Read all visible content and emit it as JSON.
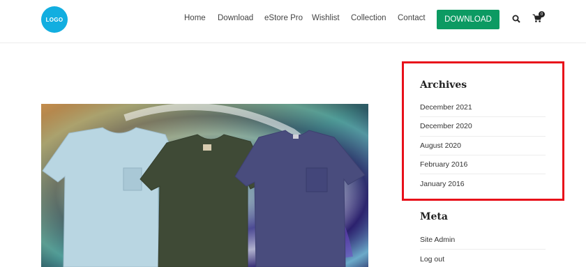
{
  "header": {
    "logo": "LOGO",
    "nav": [
      "Home",
      "Download",
      "eStore Pro",
      "Wishlist",
      "Collection",
      "Contact"
    ],
    "download_button": "DOWNLOAD",
    "cart_count": "0"
  },
  "sidebar": {
    "archives": {
      "title": "Archives",
      "items": [
        "December 2021",
        "December 2020",
        "August 2020",
        "February 2016",
        "January 2016"
      ]
    },
    "meta": {
      "title": "Meta",
      "items": [
        "Site Admin",
        "Log out"
      ]
    }
  },
  "colors": {
    "accent": "#0c9a62",
    "logo": "#12aee0",
    "highlight": "#e8101a"
  }
}
